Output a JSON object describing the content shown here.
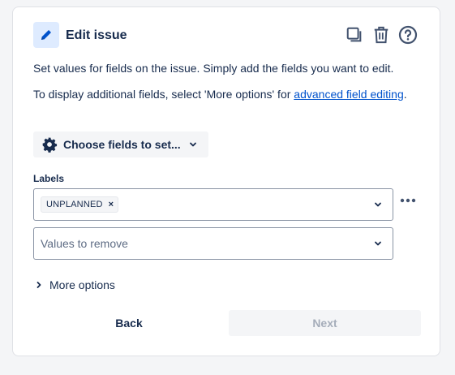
{
  "header": {
    "title": "Edit issue",
    "icon": "pencil-icon",
    "actions": [
      "duplicate-icon",
      "trash-icon",
      "help-icon"
    ],
    "accent": "#0052cc",
    "icon_bg": "#deebff"
  },
  "description": {
    "line1": "Set values for fields on the issue. Simply add the fields you want to edit.",
    "line2_prefix": "To display additional fields, select 'More options' for ",
    "line2_link": "advanced field editing",
    "line2_suffix": "."
  },
  "choose_fields": {
    "label": "Choose fields to set..."
  },
  "labels_field": {
    "label": "Labels",
    "tags": [
      "UNPLANNED"
    ],
    "remove_placeholder": "Values to remove"
  },
  "more_options": {
    "label": "More options"
  },
  "footer": {
    "back_label": "Back",
    "next_label": "Next"
  }
}
